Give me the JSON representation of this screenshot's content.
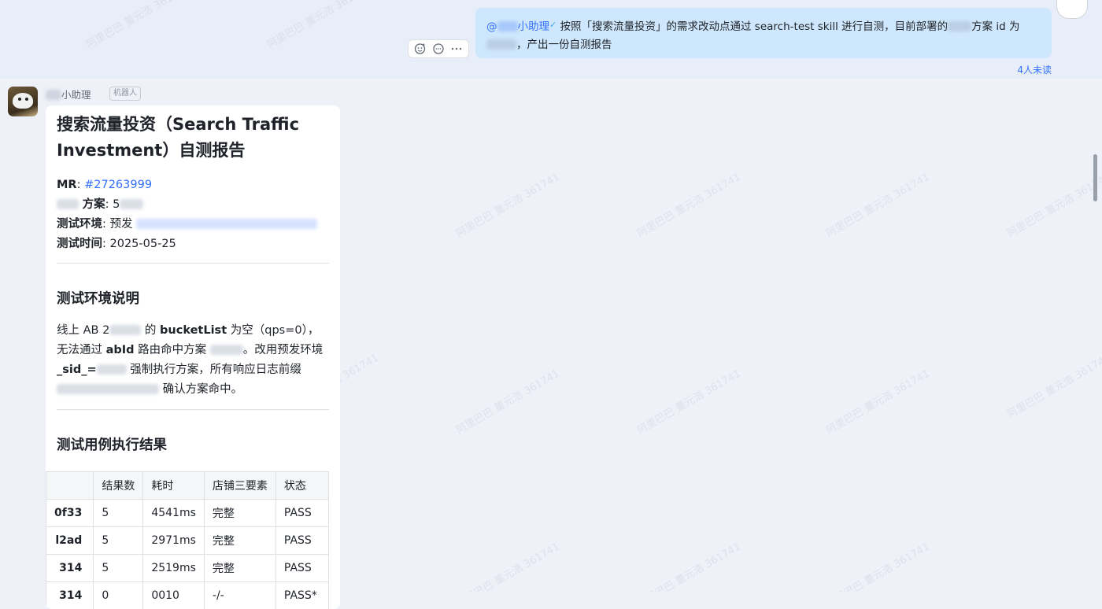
{
  "sent_message": {
    "mention": "@",
    "mention_name": "小助理",
    "text_1": "按照「搜索流量投资」的需求改动点通过 search-test skill 进行自测，目前部署的",
    "text_2": "方案 id 为",
    "text_3": "，产出一份自测报告",
    "read_status": "4人未读"
  },
  "bot": {
    "name": "小助理",
    "tag": "机器人"
  },
  "report": {
    "title": "搜索流量投资（Search Traffic Investment）自测报告",
    "mr_label": "MR",
    "mr_value": "#27263999",
    "plan_label": "方案",
    "plan_value": "5",
    "env_label": "测试环境",
    "env_value": "预发",
    "time_label": "测试时间",
    "time_value": "2025-05-25",
    "env_section_title": "测试环境说明",
    "env_desc": {
      "p1": "线上 AB 2",
      "p2": " 的 ",
      "bucket": "bucketList",
      "p3": " 为空（qps=0），无法通过 ",
      "abid": "abId",
      "p4": " 路由命中方案 ",
      "p5": "。改用预发环境 ",
      "sid": "_sid_=",
      "p6": " 强制执行方案，所有响应日志前缀 ",
      "p7": " 确认方案命中。"
    },
    "cases_section_title": "测试用例执行结果",
    "table": {
      "headers": [
        "",
        "结果数",
        "耗时",
        "店铺三要素",
        "状态"
      ],
      "rows": [
        [
          "0f33",
          "5",
          "4541ms",
          "完整",
          "PASS"
        ],
        [
          "l2ad",
          "5",
          "2971ms",
          "完整",
          "PASS"
        ],
        [
          "314",
          "5",
          "2519ms",
          "完整",
          "PASS"
        ],
        [
          "314",
          "0",
          "0010",
          "-/-",
          "PASS*"
        ]
      ]
    }
  },
  "watermark_text": "阿里巴巴 董元浩 361741",
  "colors": {
    "link": "#3370ff",
    "sent_bubble": "#cfe7fc",
    "background": "#eef1f7"
  }
}
